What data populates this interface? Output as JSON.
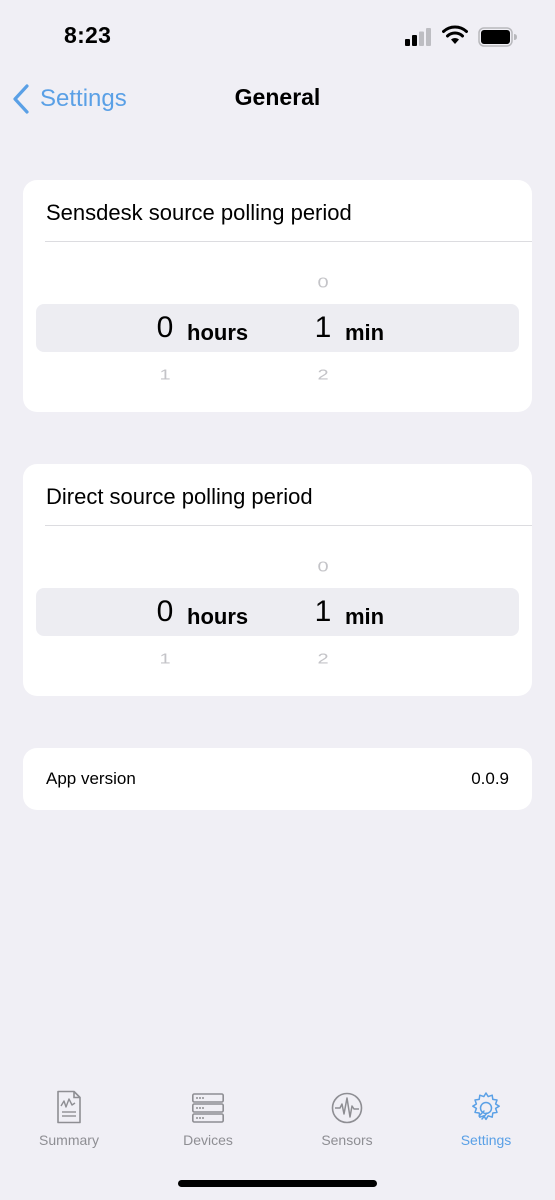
{
  "status_bar": {
    "time": "8:23"
  },
  "nav": {
    "back_label": "Settings",
    "title": "General"
  },
  "sensdesk_card": {
    "title": "Sensdesk source polling period",
    "hours": {
      "above": "",
      "selected": "0",
      "below": "1",
      "unit": "hours"
    },
    "minutes": {
      "above": "0",
      "selected": "1",
      "below": "2",
      "unit": "min"
    }
  },
  "direct_card": {
    "title": "Direct source polling period",
    "hours": {
      "above": "",
      "selected": "0",
      "below": "1",
      "unit": "hours"
    },
    "minutes": {
      "above": "0",
      "selected": "1",
      "below": "2",
      "unit": "min"
    }
  },
  "version_card": {
    "label": "App version",
    "value": "0.0.9"
  },
  "tab_bar": {
    "tabs": [
      {
        "label": "Summary",
        "icon": "summary-document-icon",
        "active": false
      },
      {
        "label": "Devices",
        "icon": "devices-server-icon",
        "active": false
      },
      {
        "label": "Sensors",
        "icon": "sensors-waveform-icon",
        "active": false
      },
      {
        "label": "Settings",
        "icon": "settings-gear-wrench-icon",
        "active": true
      }
    ]
  },
  "colors": {
    "accent": "#5aa0e6",
    "background": "#f0eff5",
    "inactive_tab": "#8e8e93"
  }
}
